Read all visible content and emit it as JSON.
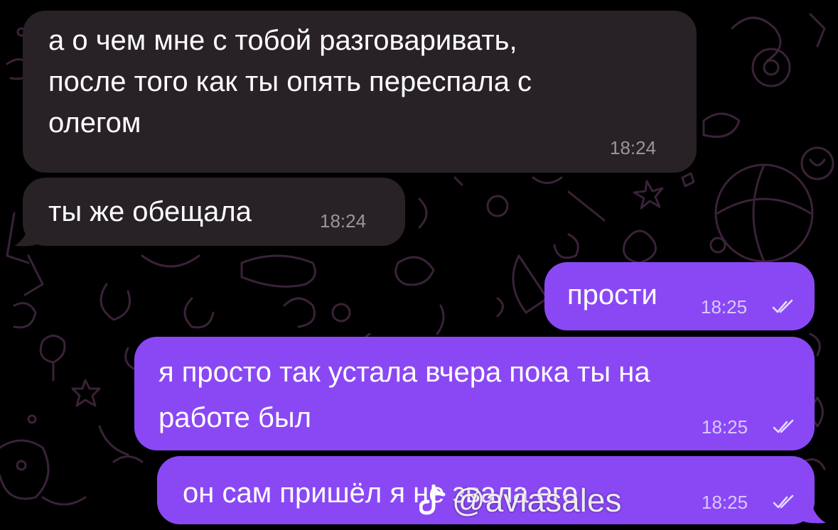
{
  "messages": [
    {
      "direction": "incoming",
      "lines": [
        "а о чем мне с тобой разговаривать,",
        "после того как ты опять переспала с",
        "олегом"
      ],
      "time": "18:24"
    },
    {
      "direction": "incoming",
      "lines": [
        "ты же обещала"
      ],
      "time": "18:24"
    },
    {
      "direction": "outgoing",
      "lines": [
        "прости"
      ],
      "time": "18:25",
      "status": "read"
    },
    {
      "direction": "outgoing",
      "lines": [
        "я просто так устала вчера пока ты на",
        "работе был"
      ],
      "time": "18:25",
      "status": "read"
    },
    {
      "direction": "outgoing",
      "lines": [
        "он сам пришёл я не звала его"
      ],
      "time": "18:25",
      "status": "read"
    }
  ],
  "watermark": {
    "icon": "tiktok-icon",
    "handle": "@aviasales"
  },
  "colors": {
    "background": "#000000",
    "incoming_bubble": "#282227",
    "outgoing_bubble": "#8a48f5",
    "pattern": "#3a2238"
  }
}
